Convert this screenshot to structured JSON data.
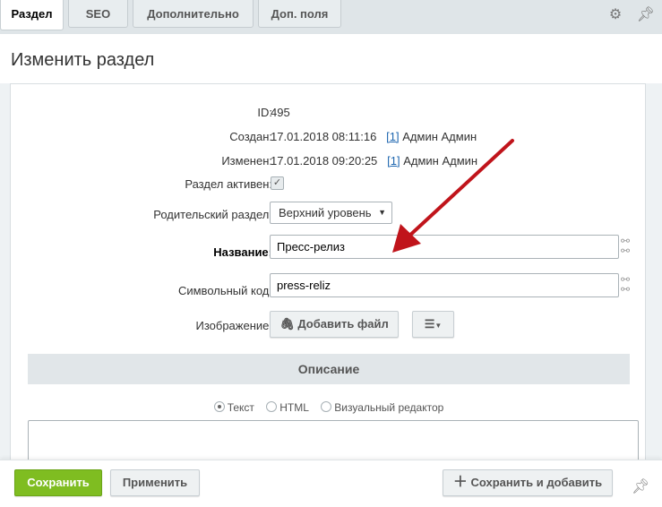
{
  "tabs": [
    {
      "label": "Раздел"
    },
    {
      "label": "SEO"
    },
    {
      "label": "Дополнительно"
    },
    {
      "label": "Доп. поля"
    }
  ],
  "tabbar_icons": {
    "settings": "gear-icon",
    "pin": "pin-icon"
  },
  "page_title": "Изменить раздел",
  "fields": {
    "id_label": "ID:",
    "id_value": "495",
    "created_label": "Создан:",
    "created_value": "17.01.2018 08:11:16",
    "created_user_link": "[1]",
    "created_user": "Админ Админ",
    "modified_label": "Изменен:",
    "modified_value": "17.01.2018 09:20:25",
    "modified_user_link": "[1]",
    "modified_user": "Админ Админ",
    "active_label": "Раздел активен:",
    "active_checked": true,
    "parent_label": "Родительский раздел:",
    "parent_value": "Верхний уровень",
    "name_label": "Название:",
    "name_value": "Пресс-релиз",
    "code_label": "Символьный код:",
    "code_value": "press-reliz",
    "image_label": "Изображение:",
    "add_file_label": "Добавить файл"
  },
  "description": {
    "section_title": "Описание",
    "modes": [
      {
        "label": "Текст",
        "selected": true
      },
      {
        "label": "HTML",
        "selected": false
      },
      {
        "label": "Визуальный редактор",
        "selected": false
      }
    ]
  },
  "footer": {
    "save_label": "Сохранить",
    "apply_label": "Применить",
    "save_add_label": "Сохранить и добавить"
  },
  "colors": {
    "accent_green": "#7fbd21",
    "link_blue": "#2067b0",
    "arrow_red": "#c0141b"
  }
}
